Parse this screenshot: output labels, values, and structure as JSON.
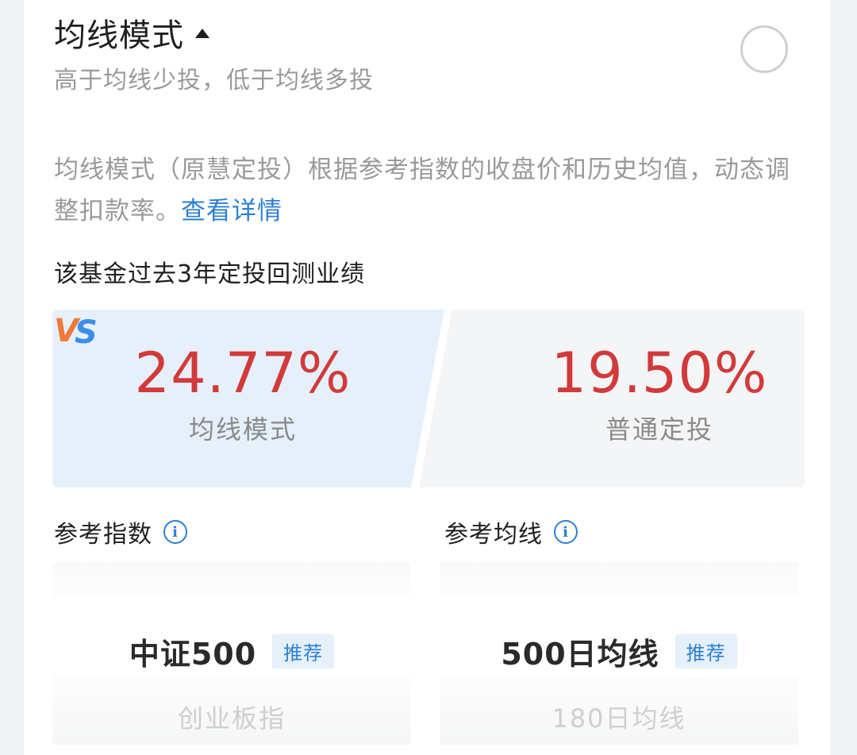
{
  "mode": {
    "title": "均线模式",
    "subtitle": "高于均线少投，低于均线多投",
    "description": "均线模式（原慧定投）根据参考指数的收盘价和历史均值，动态调整扣款率。",
    "details_link": "查看详情"
  },
  "backtest": {
    "title": "该基金过去3年定投回测业绩",
    "left": {
      "value": "24.77%",
      "label": "均线模式"
    },
    "vs_label": "VS",
    "right": {
      "value": "19.50%",
      "label": "普通定投"
    }
  },
  "reference_index": {
    "header": "参考指数",
    "selected": "中证500",
    "tag": "推荐",
    "next_option": "创业板指"
  },
  "reference_ma": {
    "header": "参考均线",
    "selected": "500日均线",
    "tag": "推荐",
    "next_option": "180日均线"
  },
  "colors": {
    "accent_blue": "#2b7fd4",
    "return_red": "#d23a3a",
    "vs_orange": "#f07a3a",
    "vs_blue": "#3a8ee6"
  },
  "icons": {
    "caret": "caret-up-icon",
    "radio": "radio-unchecked-icon",
    "info": "info-icon"
  }
}
